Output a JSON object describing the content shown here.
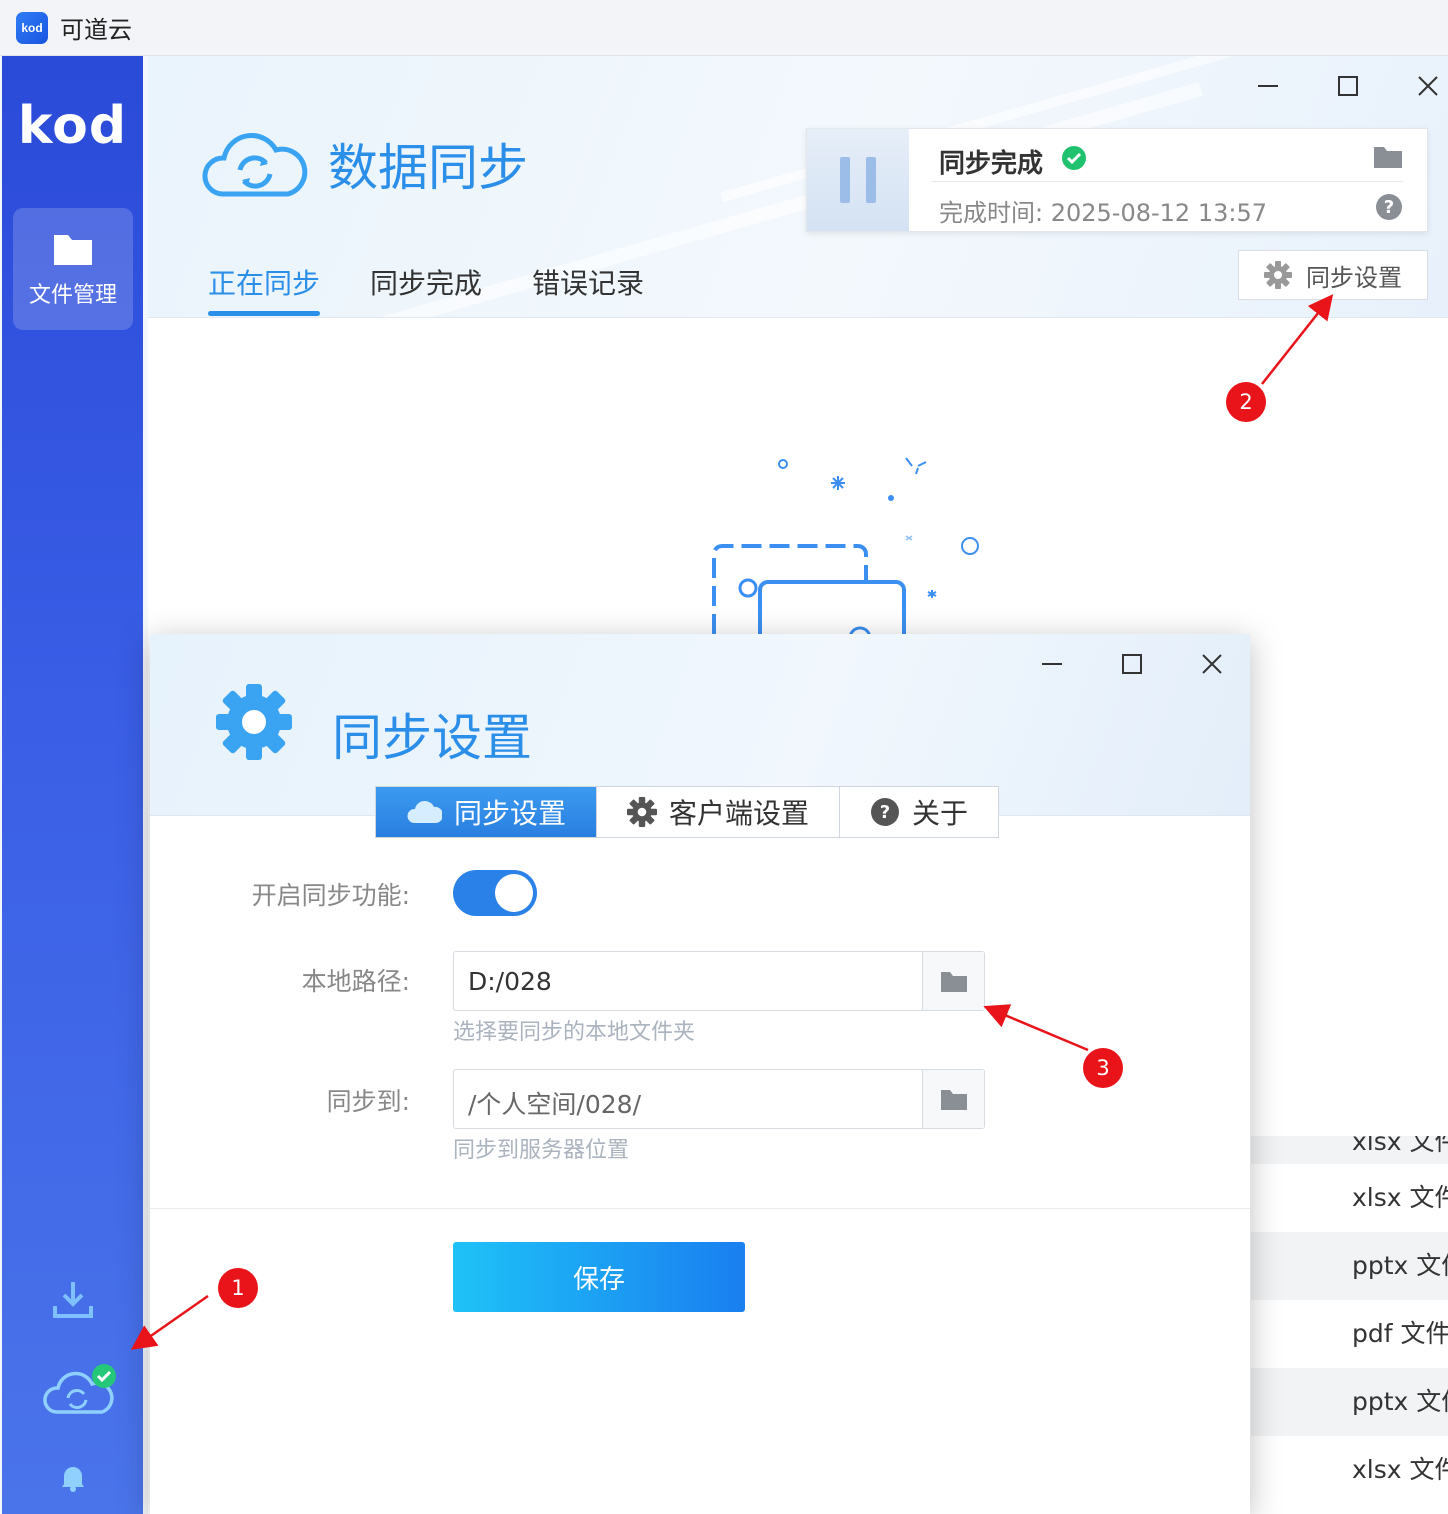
{
  "app": {
    "title": "可道云",
    "logo_text": "kod"
  },
  "sidebar": {
    "brand": "kod",
    "items": [
      {
        "label": "文件管理"
      }
    ]
  },
  "main": {
    "title": "数据同步",
    "tabs": [
      {
        "label": "正在同步",
        "active": true
      },
      {
        "label": "同步完成",
        "active": false
      },
      {
        "label": "错误记录",
        "active": false
      }
    ],
    "status": {
      "title": "同步完成",
      "time": "完成时间: 2025-08-12 13:57"
    },
    "settings_button": "同步设置",
    "file_rows": [
      "xlsx 文件",
      "pptx 文件",
      "pdf 文件",
      "pptx 文件",
      "xlsx 文件"
    ],
    "file_row_top_partial": "xlsx 文件"
  },
  "dialog": {
    "title": "同步设置",
    "tabs": [
      {
        "label": "同步设置",
        "active": true,
        "icon": "cloud-icon"
      },
      {
        "label": "客户端设置",
        "active": false,
        "icon": "gear-icon"
      },
      {
        "label": "关于",
        "active": false,
        "icon": "help-icon"
      }
    ],
    "enable_label": "开启同步功能:",
    "enable_value": true,
    "local_path_label": "本地路径:",
    "local_path_value": "D:/028",
    "local_path_hint": "选择要同步的本地文件夹",
    "sync_to_label": "同步到:",
    "sync_to_value": "/个人空间/028/",
    "sync_to_hint": "同步到服务器位置",
    "save_label": "保存"
  },
  "annotations": [
    "1",
    "2",
    "3"
  ],
  "colors": {
    "accent": "#2b8ee8",
    "sidebar": "#3a5ee6",
    "badge": "#e8141a",
    "success": "#20c270"
  }
}
